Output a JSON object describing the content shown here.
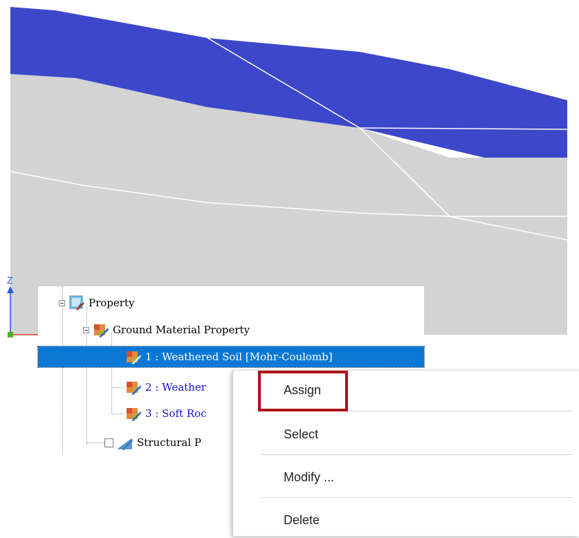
{
  "viewport": {
    "colors": {
      "background": "#ffffff",
      "top_layer": "#3c47c9",
      "ground": "#d3d3d3",
      "boundary_lines": "#ffffff"
    },
    "axis": {
      "z_label": "Z",
      "icon": "axis-triad-icon"
    }
  },
  "tree": {
    "root": {
      "label": "Property",
      "icon": "property-icon"
    },
    "group": {
      "label": "Ground Material Property",
      "icon": "material-group-icon"
    },
    "items": [
      {
        "label": "1 : Weathered Soil [Mohr-Coulomb]",
        "selected": true,
        "icon": "material-icon"
      },
      {
        "label": "2 : Weather",
        "selected": false,
        "icon": "material-icon"
      },
      {
        "label": "3 : Soft Roc",
        "selected": false,
        "icon": "material-icon"
      }
    ],
    "structural": {
      "label": "Structural P",
      "icon": "structural-property-icon",
      "checked": false
    }
  },
  "context_menu": {
    "items": [
      {
        "label": "Assign",
        "highlighted": true
      },
      {
        "label": "Select"
      },
      {
        "label": "Modify ..."
      },
      {
        "label": "Delete"
      }
    ],
    "highlight_color": "#b0121b"
  }
}
